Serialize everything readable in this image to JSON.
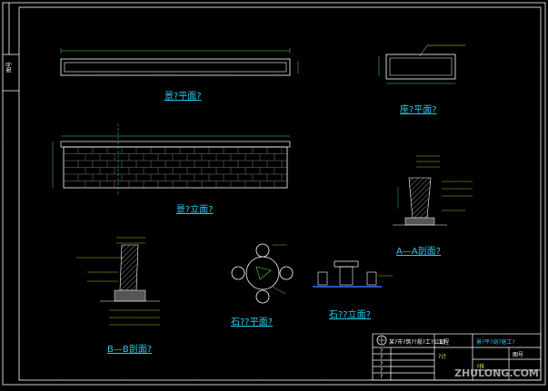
{
  "drawing": {
    "labels": {
      "plan": "景?平面?",
      "elevation": "景?立面?",
      "base_plan": "座?平面?",
      "section_a": "A—A剖面?",
      "section_b": "B—B剖面?",
      "table_plan": "石??平面?",
      "table_elev": "石??立面?"
    },
    "side_label": "图号",
    "title_block": {
      "company": "某?市?筑??规?工?公司",
      "project_label": "工程",
      "drawing_name": "景?平?剖?施工?",
      "sheet_label": "图号",
      "rows": [
        "?",
        "?",
        "?",
        "?",
        "?"
      ],
      "design": "?计",
      "check": "?核"
    },
    "watermark": "ZHULONG.COM",
    "colors": {
      "bg": "#000000",
      "cyan": "#28c8f0",
      "yellow": "#e0e040",
      "green": "#40e060",
      "white": "#ffffff",
      "wall": "#d8d8d8"
    }
  }
}
